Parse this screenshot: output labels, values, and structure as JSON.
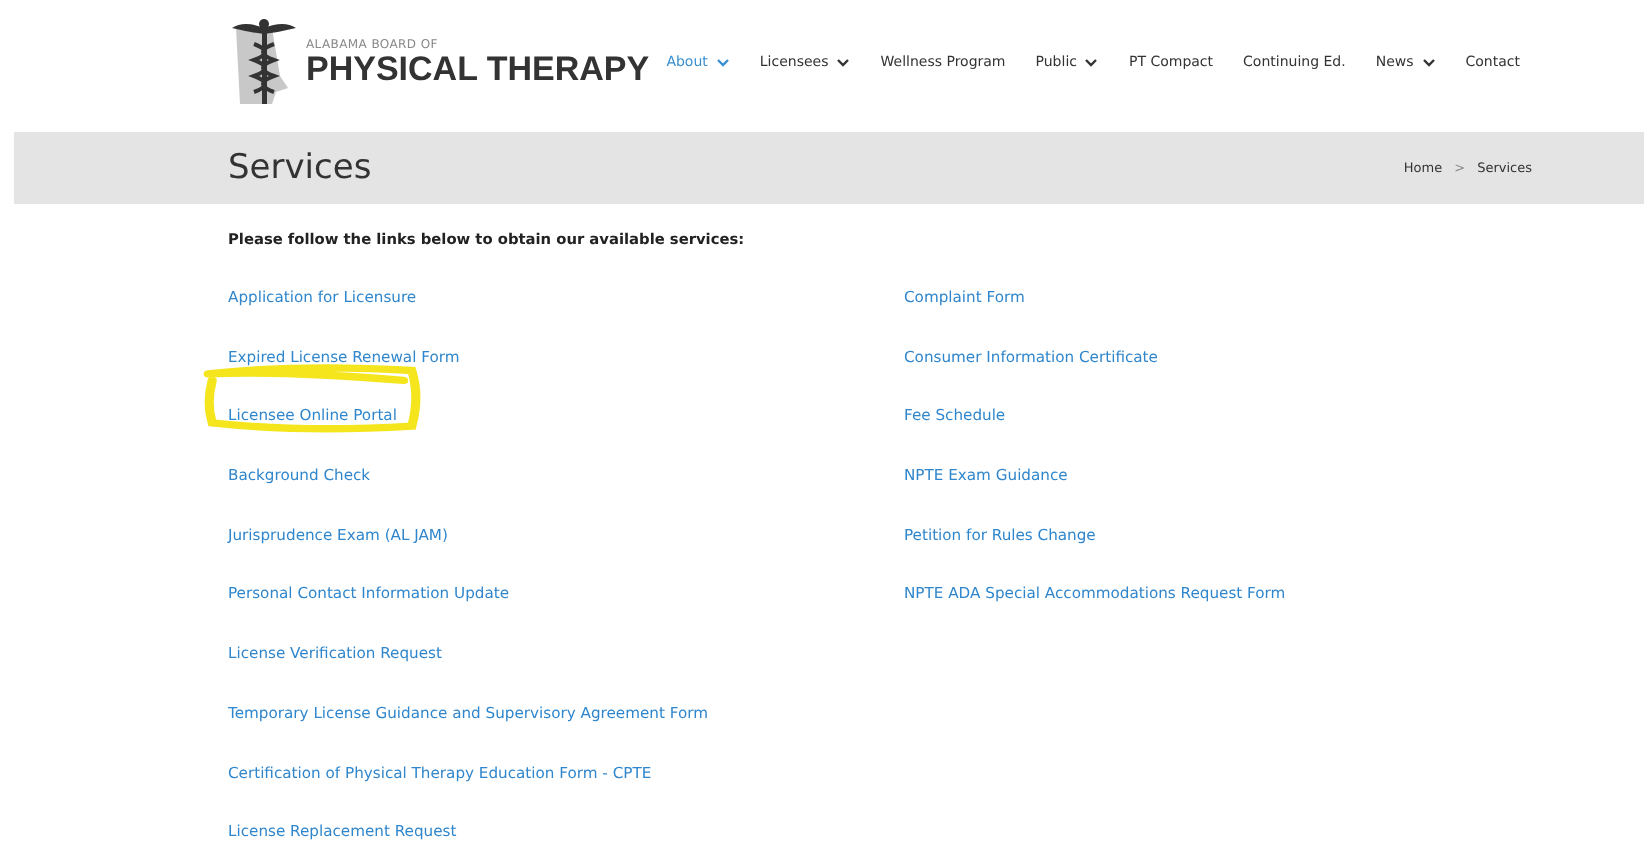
{
  "logo": {
    "small_text": "ALABAMA BOARD OF",
    "large_text": "PHYSICAL THERAPY"
  },
  "nav": [
    {
      "label": "About",
      "has_menu": true,
      "selected": true
    },
    {
      "label": "Licensees",
      "has_menu": true,
      "selected": false
    },
    {
      "label": "Wellness Program",
      "has_menu": false,
      "selected": false
    },
    {
      "label": "Public",
      "has_menu": true,
      "selected": false
    },
    {
      "label": "PT Compact",
      "has_menu": false,
      "selected": false
    },
    {
      "label": "Continuing Ed.",
      "has_menu": false,
      "selected": false
    },
    {
      "label": "News",
      "has_menu": true,
      "selected": false
    },
    {
      "label": "Contact",
      "has_menu": false,
      "selected": false
    }
  ],
  "page_title": "Services",
  "breadcrumb": {
    "separator": ">",
    "items": [
      "Home",
      "Services"
    ]
  },
  "intro": "Please follow the links below to obtain our available services:",
  "links_left": [
    {
      "label": "Application for Licensure",
      "highlighted": false
    },
    {
      "label": "Expired License Renewal Form",
      "highlighted": false
    },
    {
      "label": "Licensee Online Portal",
      "highlighted": true
    },
    {
      "label": "Background Check",
      "highlighted": false
    },
    {
      "label": "Jurisprudence Exam (AL JAM)",
      "highlighted": false
    },
    {
      "label": "Personal Contact Information Update",
      "highlighted": false
    },
    {
      "label": "License Verification Request",
      "highlighted": false
    },
    {
      "label": "Temporary License Guidance and Supervisory Agreement Form",
      "highlighted": false
    },
    {
      "label": "Certification of Physical Therapy Education Form - CPTE",
      "highlighted": false
    },
    {
      "label": "License Replacement Request",
      "highlighted": false
    }
  ],
  "links_right": [
    {
      "label": "Complaint Form",
      "highlighted": false
    },
    {
      "label": "Consumer Information Certificate",
      "highlighted": false
    },
    {
      "label": "Fee Schedule",
      "highlighted": false
    },
    {
      "label": "NPTE Exam Guidance",
      "highlighted": false
    },
    {
      "label": "Petition for Rules Change",
      "highlighted": false
    },
    {
      "label": "NPTE ADA Special Accommodations Request Form",
      "highlighted": false
    }
  ]
}
